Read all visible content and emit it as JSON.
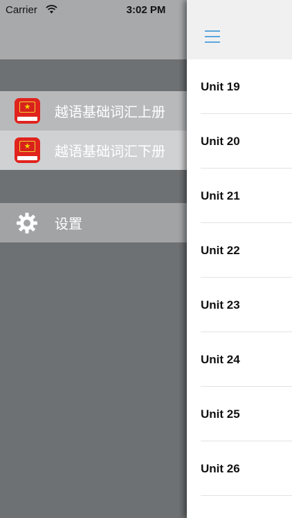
{
  "status_bar": {
    "carrier": "Carrier",
    "time": "3:02 PM",
    "wifi_icon": "wifi-icon",
    "battery_icon": "battery-icon"
  },
  "drawer": {
    "books": [
      {
        "label": "越语基础词汇上册",
        "icon": "book-app-icon"
      },
      {
        "label": "越语基础词汇下册",
        "icon": "book-app-icon"
      }
    ],
    "settings": {
      "label": "设置",
      "icon": "gear-icon"
    }
  },
  "content": {
    "menu_icon": "hamburger-menu-icon",
    "accent_color": "#5aa6dd",
    "units": [
      "Unit 19",
      "Unit 20",
      "Unit 21",
      "Unit 22",
      "Unit 23",
      "Unit 24",
      "Unit 25",
      "Unit 26"
    ]
  }
}
